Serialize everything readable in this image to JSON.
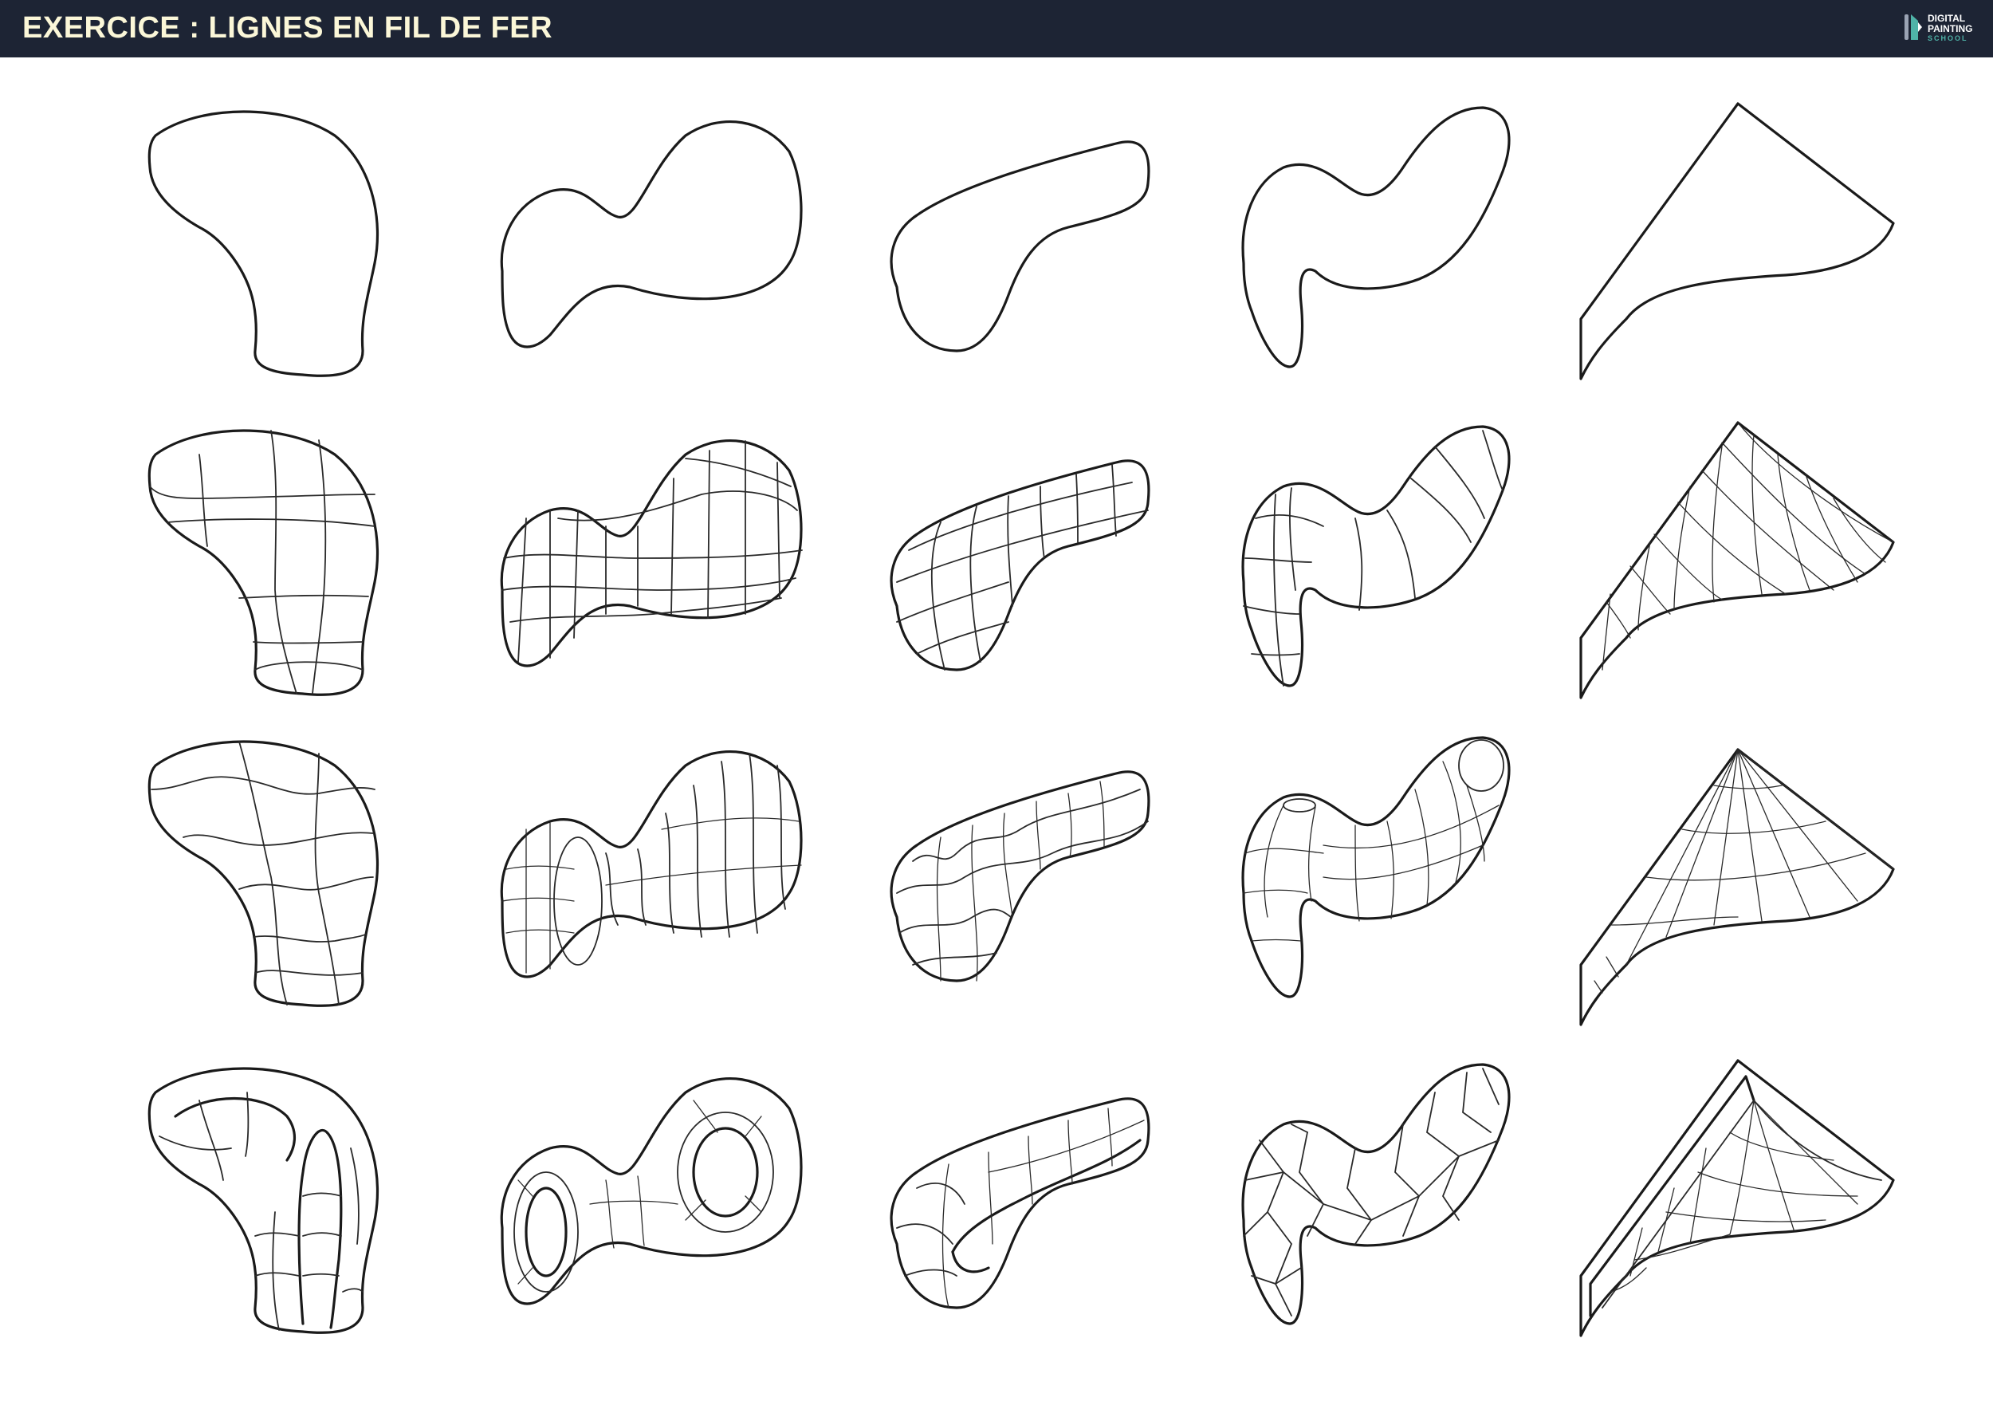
{
  "header": {
    "title": "EXERCICE : LIGNES EN FIL DE FER",
    "logo": {
      "line1": "DIGITAL",
      "line2": "PAINTING",
      "line3": "SCHOOL",
      "icon": "brush-logo-icon",
      "accent": "#4fb3a8"
    },
    "background": "#1d2434",
    "title_color": "#fbf7d8"
  },
  "sheet": {
    "rows": [
      "outline",
      "wireframe-a",
      "wireframe-b",
      "wireframe-c"
    ],
    "columns": [
      "shape-1",
      "shape-2",
      "shape-3",
      "shape-4",
      "shape-5"
    ],
    "stroke_color": "#1a1a1a"
  }
}
